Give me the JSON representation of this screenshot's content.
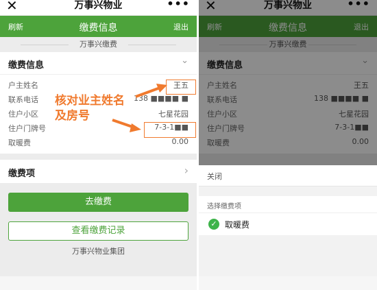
{
  "app_title": "万事兴物业",
  "navbar": {
    "refresh": "刷新",
    "title": "缴费信息",
    "logout": "退出"
  },
  "section_label": "万事兴缴费",
  "info_card": {
    "title": "缴费信息",
    "rows": [
      {
        "label": "户主姓名",
        "value": "王五"
      },
      {
        "label": "联系电话",
        "value": "138 ■■■■ ■"
      },
      {
        "label": "住户小区",
        "value": "七星花园"
      },
      {
        "label": "住户门牌号",
        "value": "7-3-1■■"
      },
      {
        "label": "取暖费",
        "value": "0.00"
      }
    ]
  },
  "fee_item": {
    "title": "缴费项"
  },
  "buttons": {
    "pay": "去缴费",
    "records": "查看缴费记录"
  },
  "footer": "万事兴物业集团",
  "annotation": {
    "text": "核对业主姓名及房号",
    "color": "#f07a2e"
  },
  "sheet": {
    "close": "关闭",
    "subtitle": "选择缴费项",
    "option": "取暖费"
  },
  "colors": {
    "brand_green": "#4da33b",
    "check_green": "#3eb34a"
  }
}
